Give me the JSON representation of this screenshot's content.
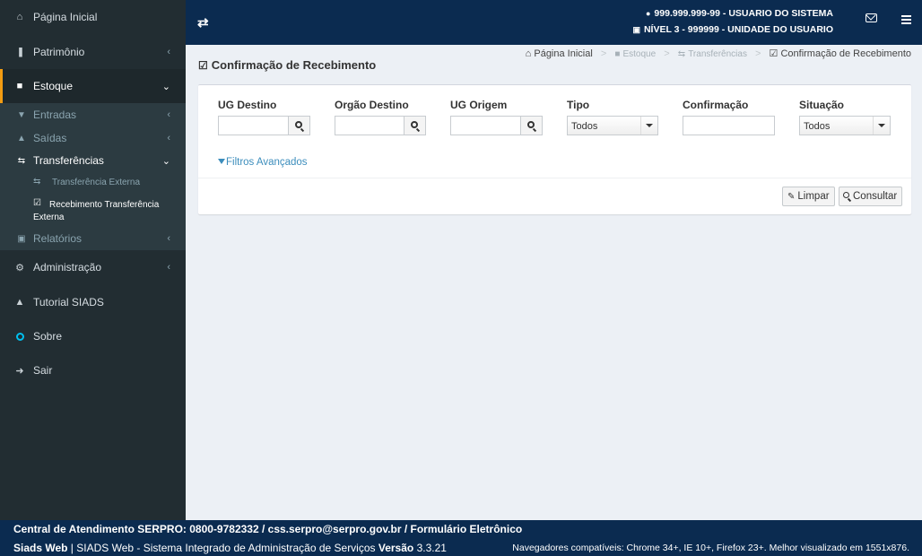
{
  "sidebar": {
    "items": [
      {
        "label": "Página Inicial",
        "icon": "home-icon"
      },
      {
        "label": "Patrimônio",
        "icon": "barcode-icon"
      },
      {
        "label": "Estoque",
        "icon": "archive-icon"
      },
      {
        "label": "Administração",
        "icon": "cogs-icon"
      },
      {
        "label": "Tutorial SIADS",
        "icon": "graduation-cap-icon"
      },
      {
        "label": "Sobre",
        "icon": "circle-icon"
      },
      {
        "label": "Sair",
        "icon": "sign-in-icon"
      }
    ],
    "estoque_submenu": [
      {
        "label": "Entradas",
        "icon": "download-icon"
      },
      {
        "label": "Saídas",
        "icon": "upload-icon"
      },
      {
        "label": "Transferências",
        "icon": "exchange-icon"
      },
      {
        "label": "Relatórios",
        "icon": "print-icon"
      }
    ],
    "transferencias_submenu": [
      {
        "label": "Transferência Externa",
        "icon": "exchange-icon"
      },
      {
        "label": "Recebimento Transferência Externa",
        "icon": "check-square-icon"
      }
    ],
    "accent_color": "#f39c12"
  },
  "topbar": {
    "user_line": "999.999.999-99 - USUARIO DO SISTEMA",
    "level_line": "NÍVEL 3 - 999999 - UNIDADE DO USUARIO",
    "background_color": "#0b2b50"
  },
  "page": {
    "title": "Confirmação de Recebimento"
  },
  "breadcrumb": {
    "items": [
      "Página Inicial",
      "Estoque",
      "Transferências",
      "Confirmação de Recebimento"
    ]
  },
  "filters": {
    "ug_destino": {
      "label": "UG Destino",
      "value": ""
    },
    "orgao_destino": {
      "label": "Orgão Destino",
      "value": ""
    },
    "ug_origem": {
      "label": "UG Origem",
      "value": ""
    },
    "tipo": {
      "label": "Tipo",
      "value": "Todos"
    },
    "confirmacao": {
      "label": "Confirmação",
      "value": ""
    },
    "situacao": {
      "label": "Situação",
      "value": "Todos"
    },
    "advanced_label": "Filtros Avançados",
    "clear_label": "Limpar",
    "search_label": "Consultar",
    "link_color": "#3c8dbc"
  },
  "footer": {
    "contact": "Central de Atendimento SERPRO: 0800-9782332 / css.serpro@serpro.gov.br / Formulário Eletrônico",
    "app_name": "Siads Web",
    "app_desc": " | SIADS Web - Sistema Integrado de Administração de Serviços ",
    "version_label": "Versão",
    "version": " 3.3.21",
    "browsers": "Navegadores compatíveis: Chrome 34+, IE 10+, Firefox 23+. Melhor visualizado em 1551x876."
  }
}
